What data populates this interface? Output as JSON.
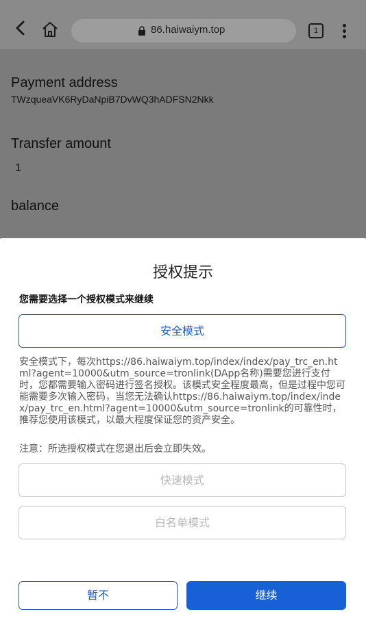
{
  "browser": {
    "url": "86.haiwaiym.top",
    "tab_count": "1"
  },
  "page": {
    "payment_address_label": "Payment address",
    "payment_address_value": "TWzqueaVK6RyDaNpiB7DvWQ3hADFSN2Nkk",
    "transfer_amount_label": "Transfer amount",
    "transfer_amount_value": "1",
    "balance_label": "balance"
  },
  "sheet": {
    "title": "授权提示",
    "subtitle": "您需要选择一个授权模式来继续",
    "secure_mode": "安全模式",
    "secure_description": "安全模式下，每次https://86.haiwaiym.top/index/index/pay_trc_en.html?agent=10000&utm_source=tronlink(DApp名称)需要您进行支付时，您都需要输入密码进行签名授权。该模式安全程度最高，但是过程中您可能需要多次输入密码，当您无法确认https://86.haiwaiym.top/index/index/pay_trc_en.html?agent=10000&utm_source=tronlink的可靠性时，推荐您使用该模式，以最大程度保证您的资产安全。",
    "note": "注意：所选授权模式在您退出后会立即失效。",
    "fast_mode": "快速模式",
    "whitelist_mode": "白名单模式",
    "cancel": "暂不",
    "continue": "继续"
  },
  "colors": {
    "accent": "#1760d6",
    "overlay_dim": "#7b7b7b"
  }
}
